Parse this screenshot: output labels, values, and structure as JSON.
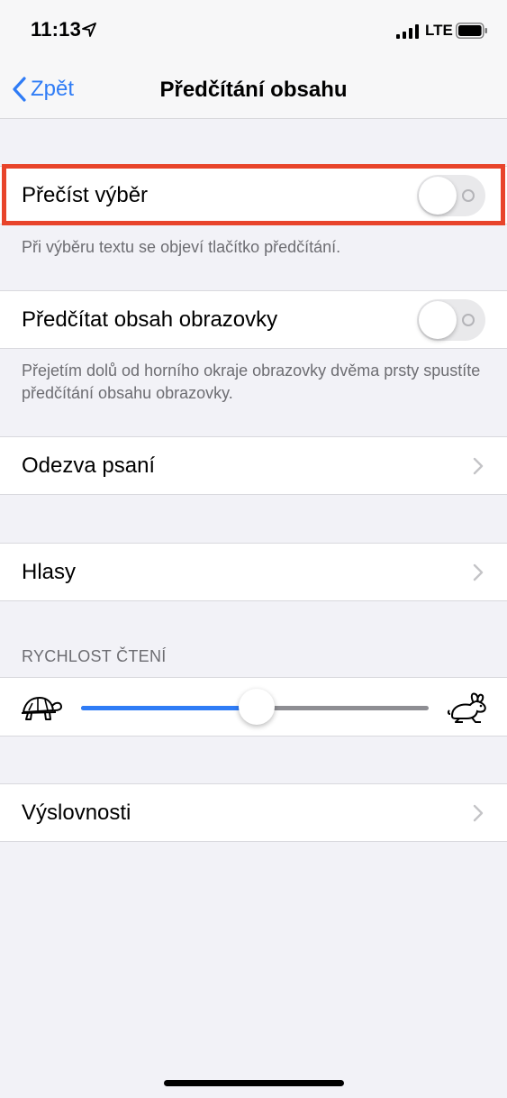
{
  "status_bar": {
    "time": "11:13",
    "network": "LTE"
  },
  "nav": {
    "back_label": "Zpět",
    "title": "Předčítání obsahu"
  },
  "rows": {
    "speak_selection": {
      "label": "Přečíst výběr",
      "on": false
    },
    "speak_selection_footer": "Při výběru textu se objeví tlačítko předčítání.",
    "speak_screen": {
      "label": "Předčítat obsah obrazovky",
      "on": false
    },
    "speak_screen_footer": "Přejetím dolů od horního okraje obrazovky dvěma prsty spustíte předčítání obsahu obrazovky.",
    "typing_feedback": {
      "label": "Odezva psaní"
    },
    "voices": {
      "label": "Hlasy"
    },
    "speaking_rate_header": "RYCHLOST ČTENÍ",
    "speaking_rate": {
      "value": 0.5
    },
    "pronunciations": {
      "label": "Výslovnosti"
    }
  },
  "colors": {
    "accent": "#2f7cf6",
    "highlight": "#e8442b"
  }
}
